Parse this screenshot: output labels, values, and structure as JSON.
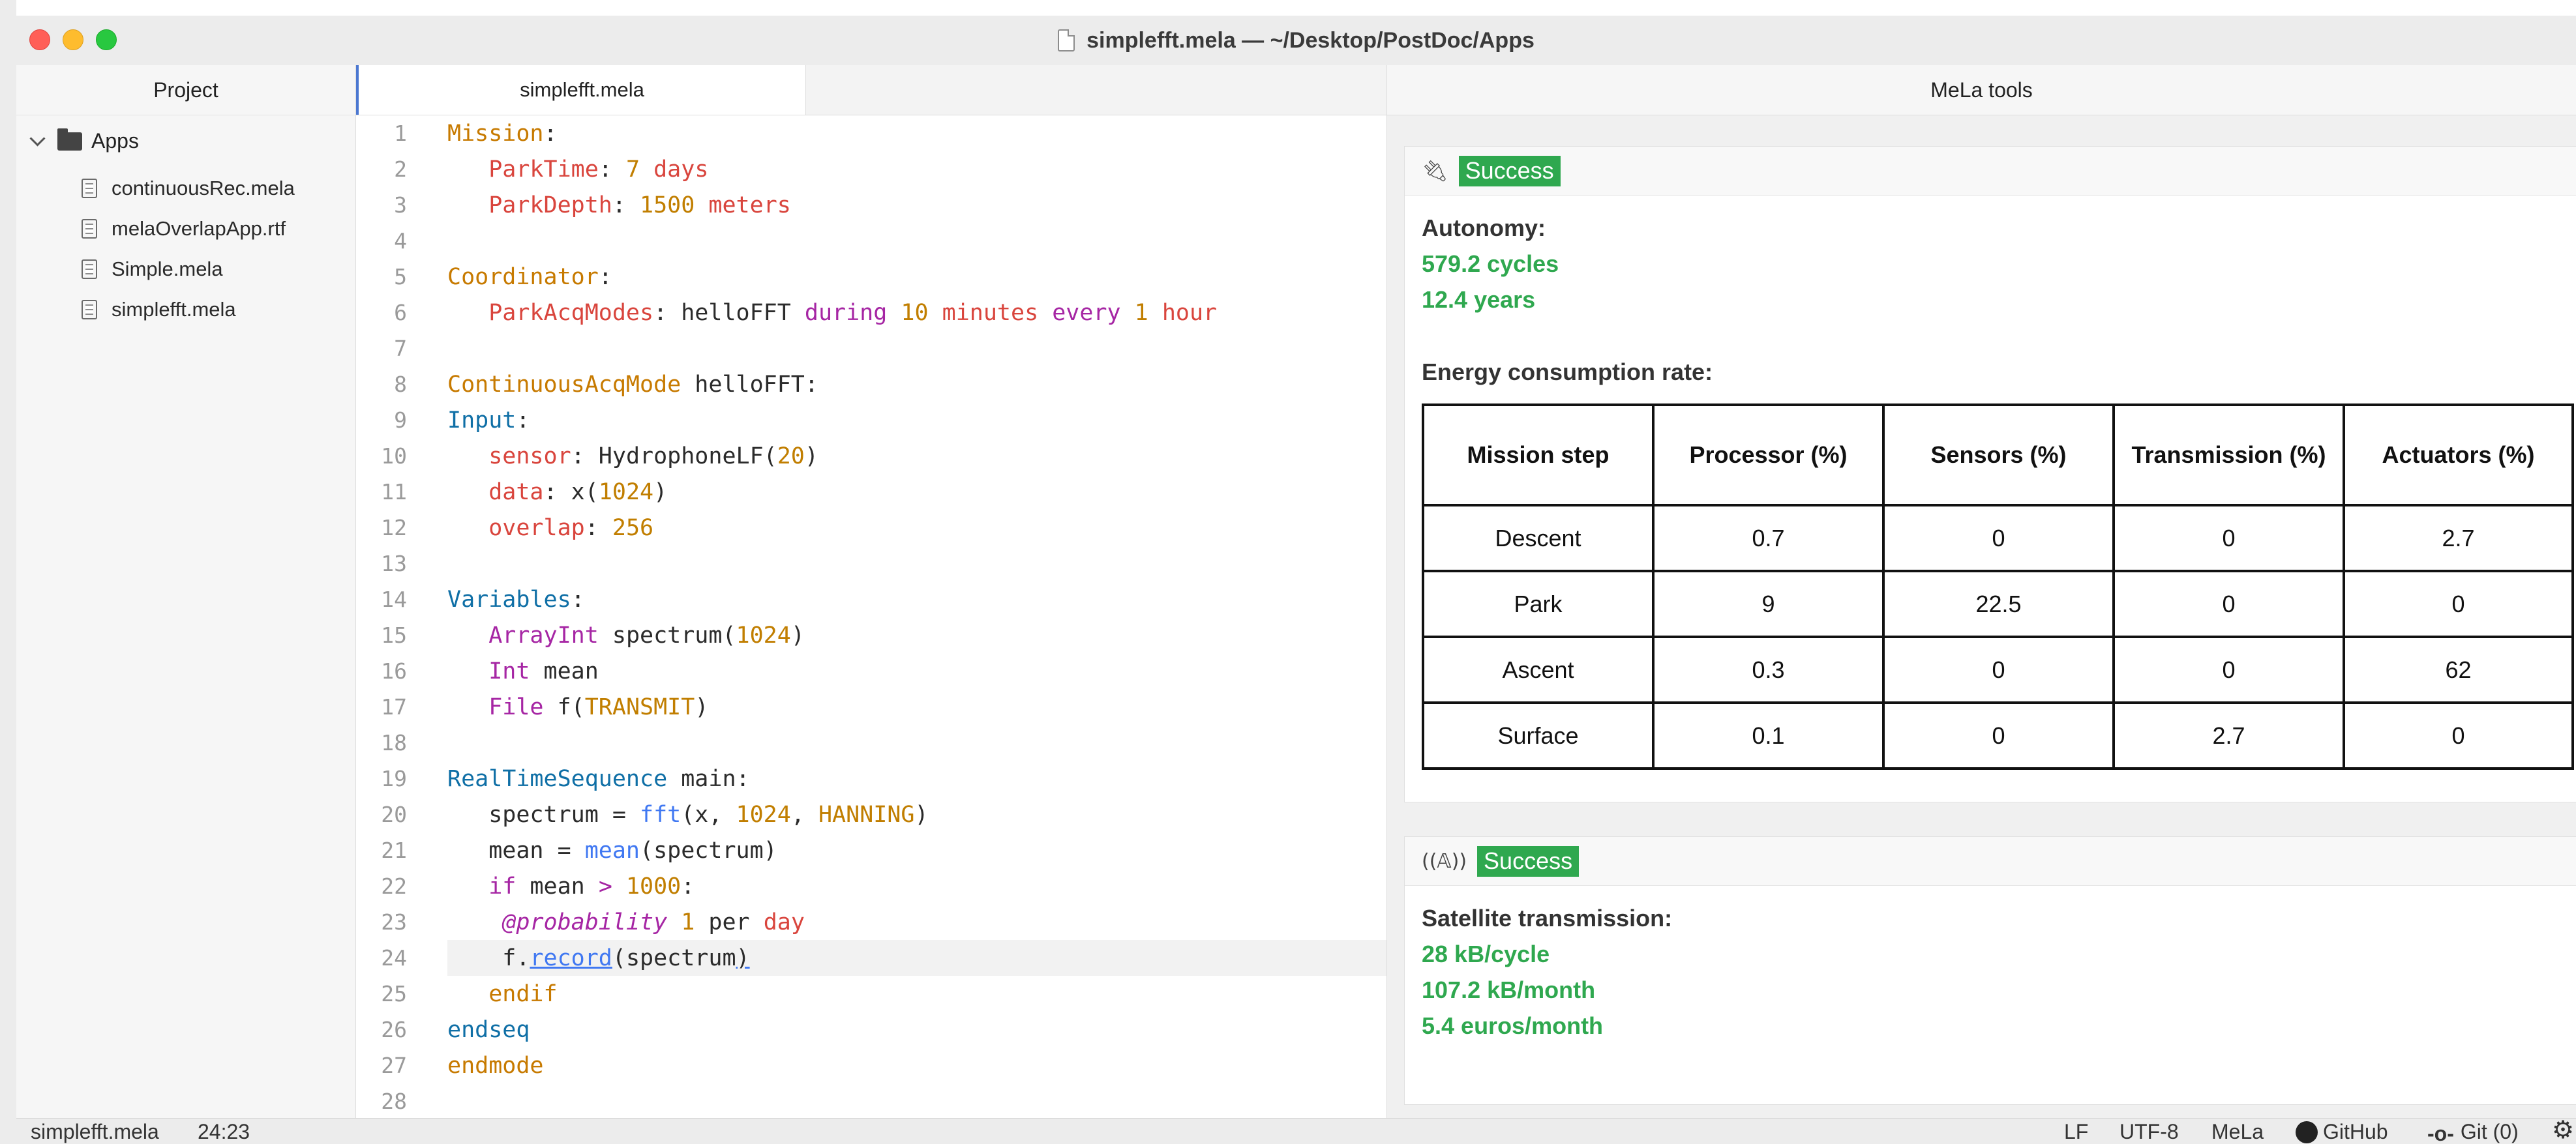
{
  "window": {
    "title": "simplefft.mela — ~/Desktop/PostDoc/Apps"
  },
  "project": {
    "header": "Project",
    "folder": "Apps",
    "files": [
      "continuousRec.mela",
      "melaOverlapApp.rtf",
      "Simple.mela",
      "simplefft.mela"
    ]
  },
  "editor": {
    "tab": "simplefft.mela",
    "line_numbers": [
      "1",
      "2",
      "3",
      "4",
      "5",
      "6",
      "7",
      "8",
      "9",
      "10",
      "11",
      "12",
      "13",
      "14",
      "15",
      "16",
      "17",
      "18",
      "19",
      "20",
      "21",
      "22",
      "23",
      "24",
      "25",
      "26",
      "27",
      "28"
    ]
  },
  "tools": {
    "header": "MeLa tools",
    "energy_card": {
      "badge": "Success",
      "icon": "plug-icon",
      "autonomy_label": "Autonomy:",
      "cycles": "579.2 cycles",
      "years": "12.4 years",
      "table_title": "Energy consumption rate:",
      "columns": [
        "Mission step",
        "Processor (%)",
        "Sensors (%)",
        "Transmission (%)",
        "Actuators (%)"
      ],
      "rows": [
        [
          "Descent",
          "0.7",
          "0",
          "0",
          "2.7"
        ],
        [
          "Park",
          "9",
          "22.5",
          "0",
          "0"
        ],
        [
          "Ascent",
          "0.3",
          "0",
          "0",
          "62"
        ],
        [
          "Surface",
          "0.1",
          "0",
          "2.7",
          "0"
        ]
      ]
    },
    "transmission_card": {
      "badge": "Success",
      "icon": "satellite-icon",
      "label": "Satellite transmission:",
      "per_cycle": "28 kB/cycle",
      "per_month": "107.2 kB/month",
      "cost": "5.4 euros/month"
    }
  },
  "statusbar": {
    "file": "simplefft.mela",
    "cursor": "24:23",
    "line_ending": "LF",
    "encoding": "UTF-8",
    "grammar": "MeLa",
    "github": "GitHub",
    "git": "Git (0)"
  },
  "colors": {
    "success": "#2fa84f",
    "accent": "#4b77d1"
  }
}
